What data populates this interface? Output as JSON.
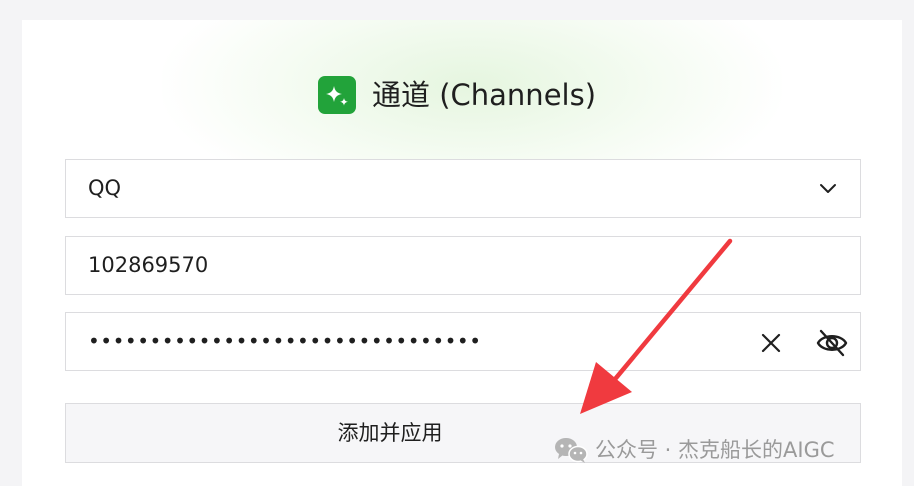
{
  "title": {
    "text": "通道 (Channels)",
    "icon": "sparkle-icon",
    "icon_color": "#22a33a"
  },
  "channel_select": {
    "value": "QQ",
    "icon": "chevron-down-icon"
  },
  "app_id_field": {
    "value": "102869570"
  },
  "secret_field": {
    "masked_value": "••••••••••••••••••••••••••••••••",
    "clear_icon": "close-icon",
    "visibility_icon": "eye-off-icon"
  },
  "add_button": {
    "label": "添加并应用"
  },
  "watermark": {
    "text": "公众号 · 杰克船长的AIGC",
    "icon": "wechat-icon"
  },
  "annotation": {
    "type": "arrow",
    "color": "#f03a3f"
  }
}
